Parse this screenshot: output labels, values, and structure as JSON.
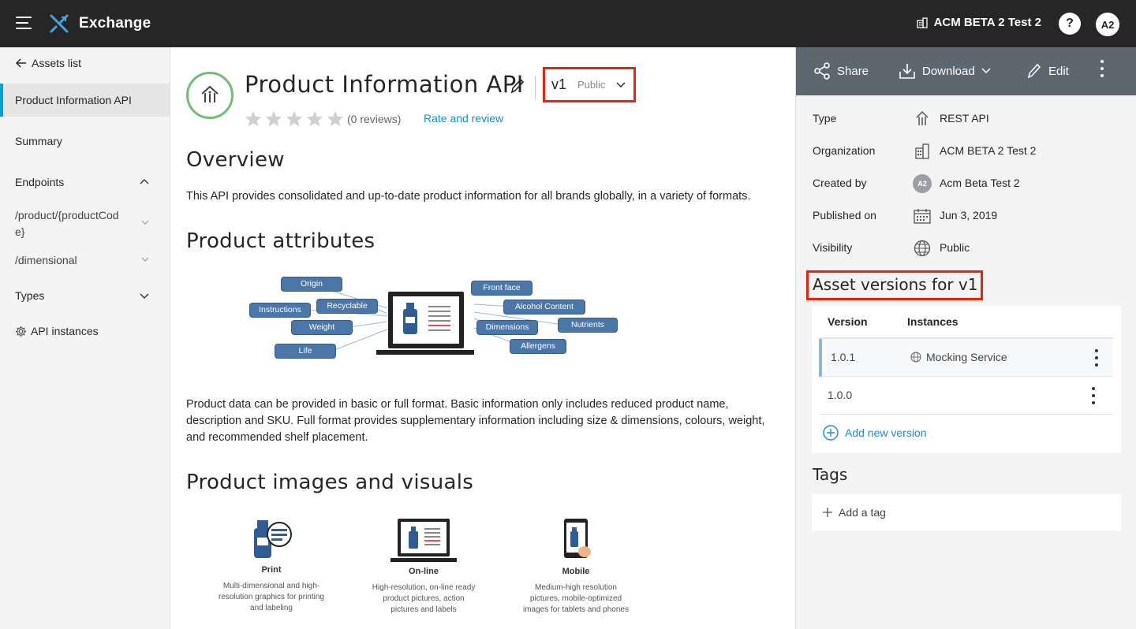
{
  "topbar": {
    "app_name": "Exchange",
    "org_name": "ACM BETA 2 Test 2",
    "help_label": "?",
    "user_initials": "A2"
  },
  "sidebar": {
    "back_label": "Assets list",
    "active_item": "Product Information API",
    "items": [
      {
        "label": "Summary"
      },
      {
        "label": "Endpoints"
      },
      {
        "label": "/product/{productCode}"
      },
      {
        "label": "/dimensional"
      },
      {
        "label": "Types"
      },
      {
        "label": "API instances"
      }
    ],
    "endpoint_line1": "/product/{productCod",
    "endpoint_line2": "e}"
  },
  "asset": {
    "title": "Product Information API",
    "version": "v1",
    "visibility": "Public",
    "reviews": "(0 reviews)",
    "rate_label": "Rate and review",
    "rating": 0,
    "max_rating": 5
  },
  "content": {
    "overview_heading": "Overview",
    "overview_text": "This API provides consolidated and up-to-date product information for all brands globally, in a variety of formats.",
    "attributes_heading": "Product attributes",
    "attributes_left": [
      "Origin",
      "Instructions",
      "Recyclable",
      "Weight",
      "Life"
    ],
    "attributes_right": [
      "Front face",
      "Alcohol Content",
      "Dimensions",
      "Nutrients",
      "Allergens"
    ],
    "format_text": "Product data can be provided in basic or full format. Basic information only includes reduced product name, description and SKU. Full format provides supplementary information including size & dimensions, colours, weight, and recommended shelf placement.",
    "images_heading": "Product images and visuals",
    "media": [
      {
        "title": "Print",
        "desc_lines": [
          "Multi-dimensional and high-",
          "resolution graphics for printing",
          "and labeling"
        ]
      },
      {
        "title": "On-line",
        "desc_lines": [
          "High-resolution, on-line ready",
          "product pictures, action",
          "pictures and labels"
        ]
      },
      {
        "title": "Mobile",
        "desc_lines": [
          "Medium-high resolution",
          "pictures, mobile-optimized",
          "images for tablets and phones"
        ]
      }
    ]
  },
  "actions": {
    "share": "Share",
    "download": "Download",
    "edit": "Edit"
  },
  "meta": {
    "type_label": "Type",
    "type_value": "REST API",
    "org_label": "Organization",
    "org_value": "ACM BETA 2 Test 2",
    "created_label": "Created by",
    "created_initials": "A2",
    "created_value": "Acm Beta Test 2",
    "published_label": "Published on",
    "published_value": "Jun 3, 2019",
    "visibility_label": "Visibility",
    "visibility_value": "Public"
  },
  "versions": {
    "heading": "Asset versions for v1",
    "col_version": "Version",
    "col_instances": "Instances",
    "rows": [
      {
        "version": "1.0.1",
        "instance": "Mocking Service"
      },
      {
        "version": "1.0.0",
        "instance": ""
      }
    ],
    "add_label": "Add new version"
  },
  "tags": {
    "heading": "Tags",
    "add_label": "Add a tag"
  },
  "colors": {
    "topbar": "#262626",
    "accent_blue": "#1b8bd3",
    "highlight_red": "#e8240d",
    "asset_icon_green": "#6fbf73",
    "action_bar": "#5c6770",
    "diagram_blue": "#4a76a8"
  }
}
